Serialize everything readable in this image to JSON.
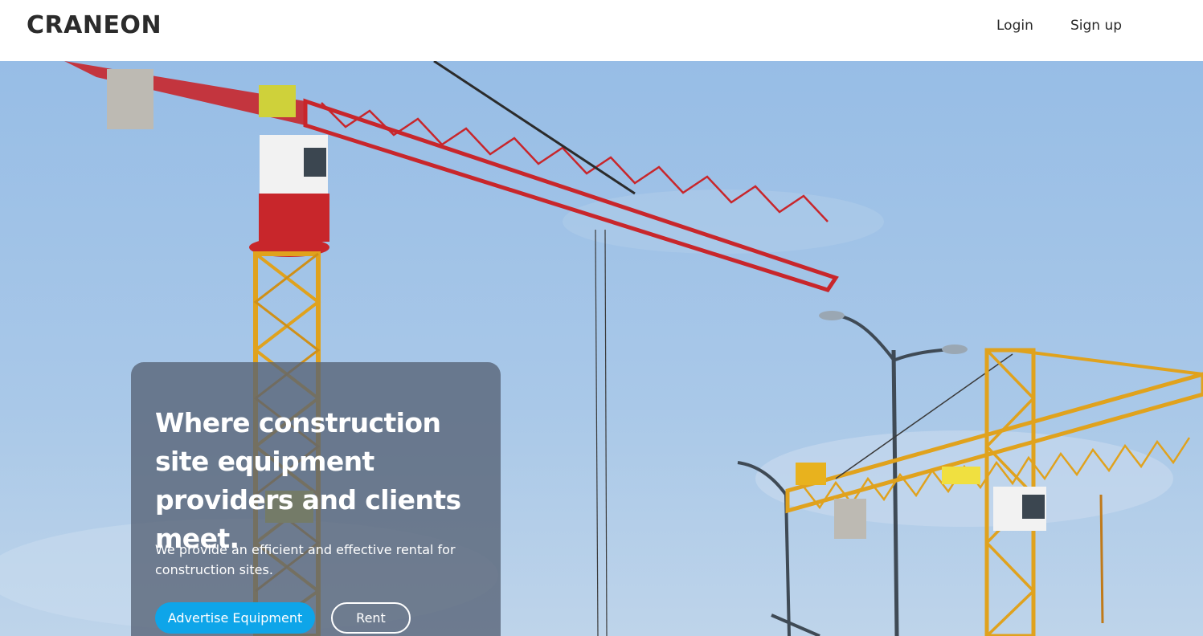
{
  "brand": {
    "name": "CRANEON"
  },
  "nav": {
    "login": "Login",
    "signup": "Sign up"
  },
  "hero": {
    "title": "Where construction site equipment providers and clients meet.",
    "subtitle": "We provide an efficient and effective rental for construction sites.",
    "primary_button": "Advertise Equipment",
    "secondary_button": "Rent",
    "image_description": "construction-cranes-photo"
  },
  "colors": {
    "accent": "#0ea5e9",
    "text_dark": "#2b2b2b",
    "sky_top": "#9cc0e6",
    "sky_bottom": "#b8d2ea",
    "crane_red": "#c8262b",
    "crane_yellow": "#e0a21d"
  }
}
